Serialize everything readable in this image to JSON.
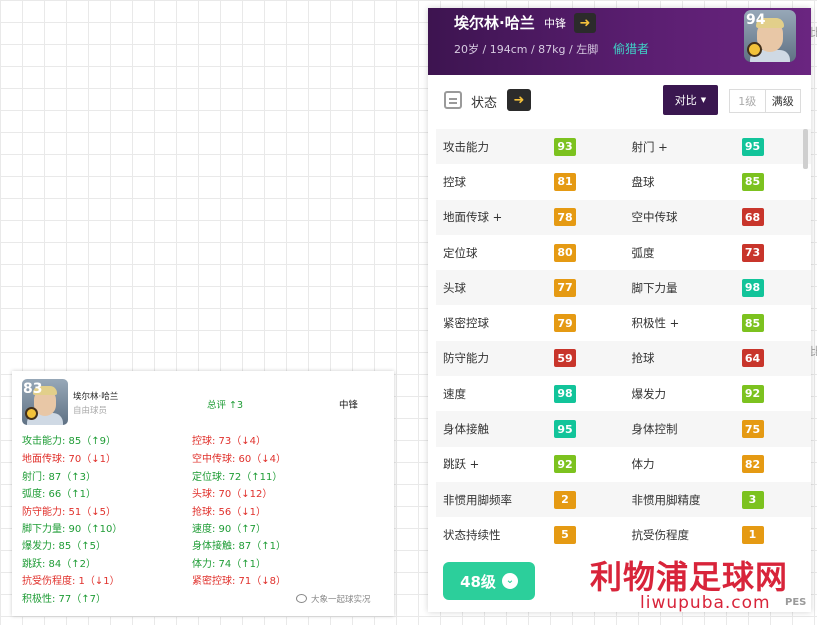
{
  "player": {
    "name": "埃尔林·哈兰",
    "position": "中锋",
    "info": "20岁 / 194cm / 87kg / 左脚",
    "play_style": "偷猎者",
    "rating": "94"
  },
  "state": {
    "label": "状态",
    "compare_label": "对比",
    "level_options": [
      "1级",
      "满级"
    ]
  },
  "stats": [
    [
      {
        "name": "攻击能力",
        "value": "93",
        "color": "#7cc21f"
      },
      {
        "name": "射门 +",
        "value": "95",
        "color": "#12c49a"
      }
    ],
    [
      {
        "name": "控球",
        "value": "81",
        "color": "#e59a13"
      },
      {
        "name": "盘球",
        "value": "85",
        "color": "#7cc21f"
      }
    ],
    [
      {
        "name": "地面传球 +",
        "value": "78",
        "color": "#e59a13"
      },
      {
        "name": "空中传球",
        "value": "68",
        "color": "#c8352b"
      }
    ],
    [
      {
        "name": "定位球",
        "value": "80",
        "color": "#e59a13"
      },
      {
        "name": "弧度",
        "value": "73",
        "color": "#c8352b"
      }
    ],
    [
      {
        "name": "头球",
        "value": "77",
        "color": "#e59a13"
      },
      {
        "name": "脚下力量",
        "value": "98",
        "color": "#12c49a"
      }
    ],
    [
      {
        "name": "紧密控球",
        "value": "79",
        "color": "#e59a13"
      },
      {
        "name": "积极性 +",
        "value": "85",
        "color": "#7cc21f"
      }
    ],
    [
      {
        "name": "防守能力",
        "value": "59",
        "color": "#c8352b"
      },
      {
        "name": "抢球",
        "value": "64",
        "color": "#c8352b"
      }
    ],
    [
      {
        "name": "速度",
        "value": "98",
        "color": "#12c49a"
      },
      {
        "name": "爆发力",
        "value": "92",
        "color": "#7cc21f"
      }
    ],
    [
      {
        "name": "身体接触",
        "value": "95",
        "color": "#12c49a"
      },
      {
        "name": "身体控制",
        "value": "75",
        "color": "#e59a13"
      }
    ],
    [
      {
        "name": "跳跃 +",
        "value": "92",
        "color": "#7cc21f"
      },
      {
        "name": "体力",
        "value": "82",
        "color": "#e59a13"
      }
    ],
    [
      {
        "name": "非惯用脚频率",
        "value": "2",
        "color": "#e59a13"
      },
      {
        "name": "非惯用脚精度",
        "value": "3",
        "color": "#7cc21f"
      }
    ],
    [
      {
        "name": "状态持续性",
        "value": "5",
        "color": "#e59a13"
      },
      {
        "name": "抗受伤程度",
        "value": "1",
        "color": "#e59a13"
      }
    ]
  ],
  "level_button": "48级",
  "watermark": {
    "cn": "利物浦足球网",
    "en": "liwupuba.com",
    "pes": "PES"
  },
  "edge_chars": [
    "比",
    "比"
  ],
  "compare_panel": {
    "rating": "83",
    "name": "埃尔林·哈兰",
    "status": "自由球员",
    "total": "总评 ↑3",
    "position": "中锋",
    "left_col": [
      {
        "text": "攻击能力: 85（↑9）",
        "dir": "up"
      },
      {
        "text": "地面传球: 70（↓1）",
        "dir": "down"
      },
      {
        "text": "射门: 87（↑3）",
        "dir": "up"
      },
      {
        "text": "弧度: 66（↑1）",
        "dir": "up"
      },
      {
        "text": "防守能力: 51（↓5）",
        "dir": "down"
      },
      {
        "text": "脚下力量: 90（↑10）",
        "dir": "up"
      },
      {
        "text": "爆发力: 85（↑5）",
        "dir": "up"
      },
      {
        "text": "跳跃: 84（↑2）",
        "dir": "up"
      },
      {
        "text": "抗受伤程度: 1（↓1）",
        "dir": "down"
      },
      {
        "text": "积极性: 77（↑7）",
        "dir": "up"
      }
    ],
    "right_col": [
      {
        "text": "控球: 73（↓4）",
        "dir": "down"
      },
      {
        "text": "空中传球: 60（↓4）",
        "dir": "down"
      },
      {
        "text": "定位球: 72（↑11）",
        "dir": "up"
      },
      {
        "text": "头球: 70（↓12）",
        "dir": "down"
      },
      {
        "text": "抢球: 56（↓1）",
        "dir": "down"
      },
      {
        "text": "速度: 90（↑7）",
        "dir": "up"
      },
      {
        "text": "身体接触: 87（↑1）",
        "dir": "up"
      },
      {
        "text": "体力: 74（↑1）",
        "dir": "up"
      },
      {
        "text": "紧密控球: 71（↓8）",
        "dir": "down"
      }
    ],
    "credit": "大象一起球实况"
  }
}
